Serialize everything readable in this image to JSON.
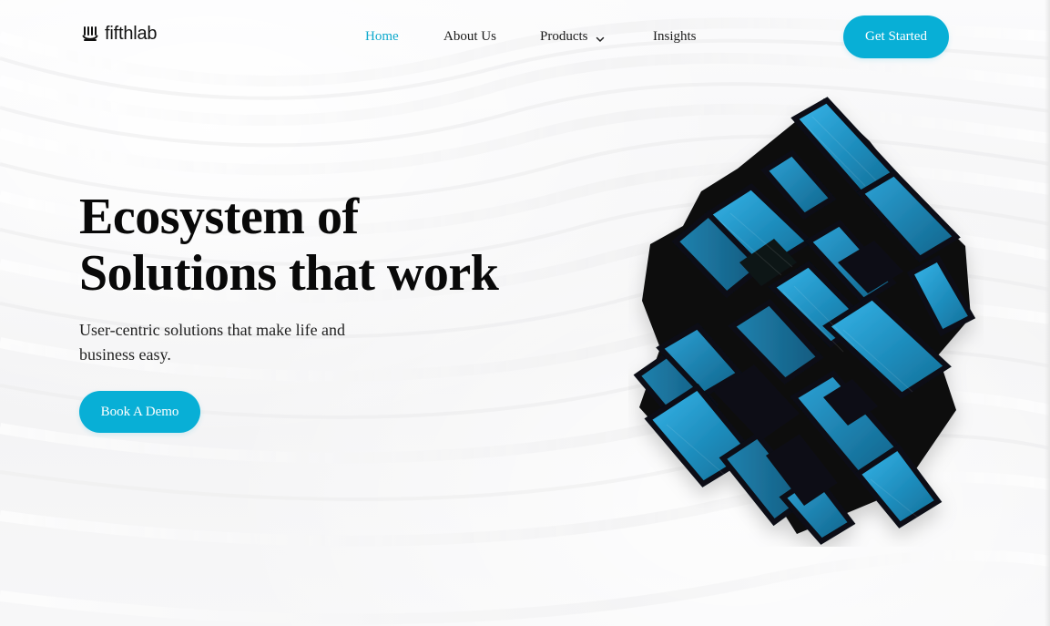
{
  "brand": {
    "name_part1": "fifth",
    "name_part2": "lab"
  },
  "nav": {
    "items": [
      {
        "label": "Home",
        "active": true
      },
      {
        "label": "About Us",
        "active": false
      },
      {
        "label": "Products",
        "active": false
      },
      {
        "label": "Insights",
        "active": false
      }
    ]
  },
  "header": {
    "cta_label": "Get Started"
  },
  "hero": {
    "title_line1": "Ecosystem of",
    "title_line2": "Solutions that work",
    "subtitle_line1": "User-centric solutions that make life and",
    "subtitle_line2": "business easy.",
    "cta_label": "Book A Demo"
  },
  "colors": {
    "accent": "#08afd6",
    "nav_active": "#10aacd",
    "text_dark": "#090909",
    "background": "#f6f6f7"
  },
  "icons": {
    "logo": "fifthlab-logo-icon",
    "dropdown": "chevron-down-icon",
    "hero_image": "cube-puzzle-illustration"
  }
}
